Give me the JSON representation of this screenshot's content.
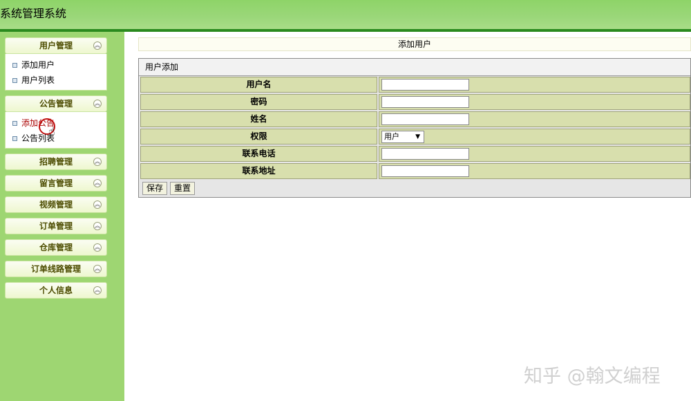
{
  "header": {
    "title": "系统管理系统"
  },
  "sidebar": {
    "groups": [
      {
        "label": "用户管理",
        "items": [
          {
            "label": "添加用户"
          },
          {
            "label": "用户列表"
          }
        ]
      },
      {
        "label": "公告管理",
        "items": [
          {
            "label": "添加公告"
          },
          {
            "label": "公告列表"
          }
        ]
      },
      {
        "label": "招聘管理"
      },
      {
        "label": "留言管理"
      },
      {
        "label": "视频管理"
      },
      {
        "label": "订单管理"
      },
      {
        "label": "仓库管理"
      },
      {
        "label": "订单线路管理"
      },
      {
        "label": "个人信息"
      }
    ],
    "expand_icon": "double-chevron-up-icon"
  },
  "main": {
    "page_title": "添加用户",
    "form": {
      "caption": "用户添加",
      "fields": [
        {
          "label": "用户名",
          "value": ""
        },
        {
          "label": "密码",
          "value": ""
        },
        {
          "label": "姓名",
          "value": ""
        },
        {
          "label": "权限",
          "value": "用户"
        },
        {
          "label": "联系电话",
          "value": ""
        },
        {
          "label": "联系地址",
          "value": ""
        }
      ],
      "save_label": "保存",
      "reset_label": "重置"
    }
  },
  "watermark": "知乎 @翰文编程",
  "colors": {
    "header": "#9bd77a",
    "header_bar": "#2a8a1e",
    "sidebar": "#9ed672",
    "label_cell": "#d8dfad"
  }
}
